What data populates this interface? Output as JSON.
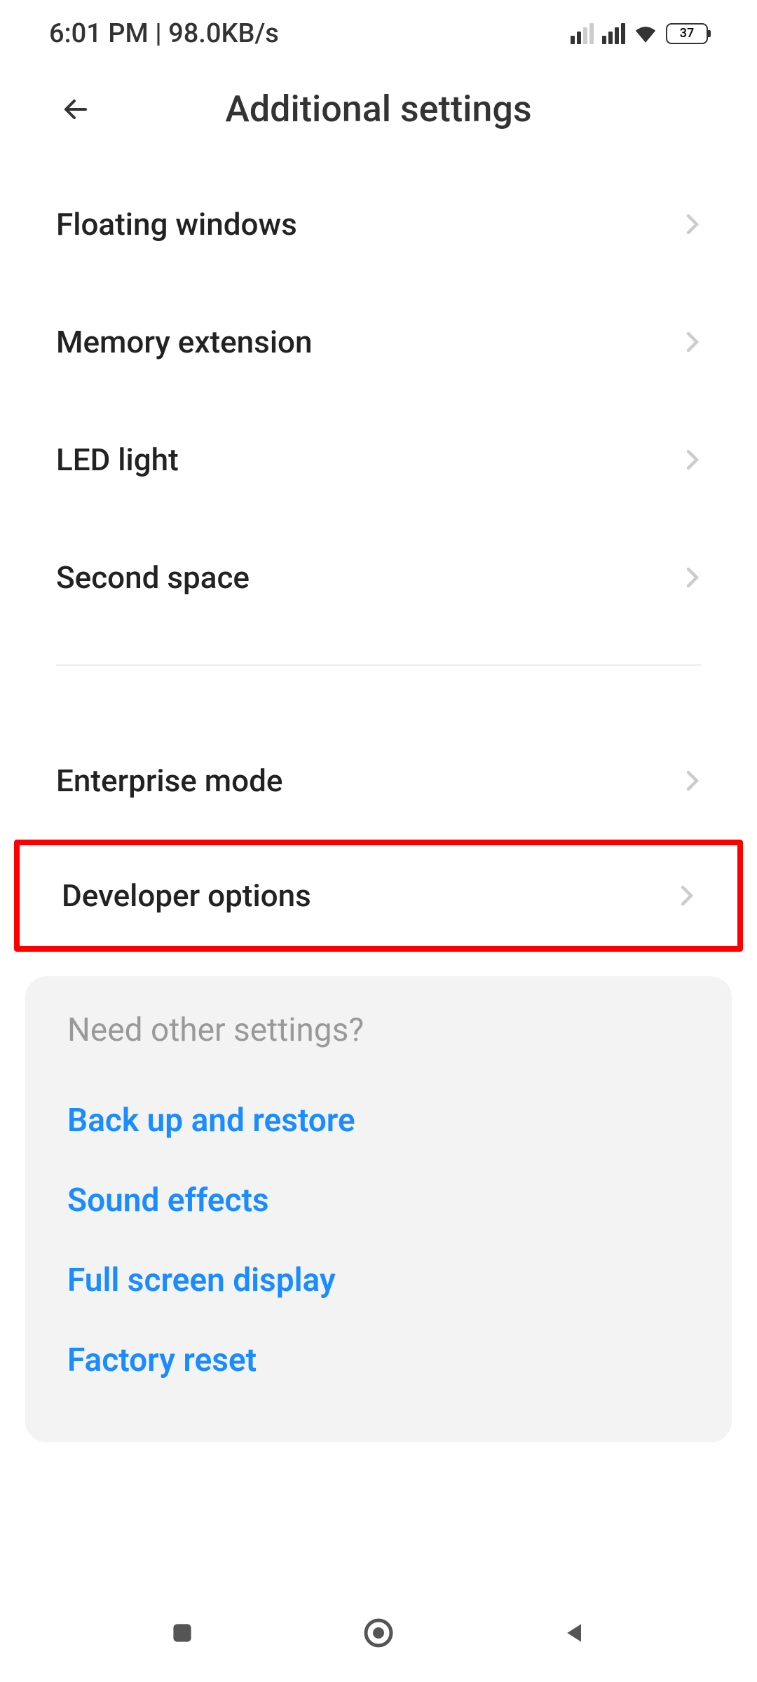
{
  "statusBar": {
    "time": "6:01 PM",
    "speed": "98.0KB/s",
    "batteryLevel": "37"
  },
  "header": {
    "title": "Additional settings"
  },
  "settings": {
    "group1": [
      {
        "label": "Floating windows"
      },
      {
        "label": "Memory extension"
      },
      {
        "label": "LED light"
      },
      {
        "label": "Second space"
      }
    ],
    "group2": [
      {
        "label": "Enterprise mode",
        "highlighted": false
      },
      {
        "label": "Developer options",
        "highlighted": true
      }
    ]
  },
  "otherSettings": {
    "title": "Need other settings?",
    "links": [
      {
        "label": "Back up and restore"
      },
      {
        "label": "Sound effects"
      },
      {
        "label": "Full screen display"
      },
      {
        "label": "Factory reset"
      }
    ]
  }
}
